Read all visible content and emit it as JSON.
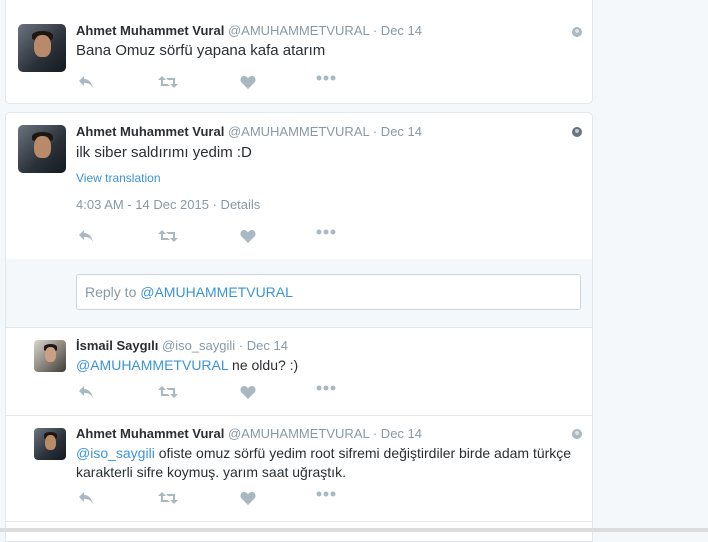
{
  "tweets": [
    {
      "name": "Ahmet Muhammet Vural",
      "handle": "@AMUHAMMETVURAL",
      "date": "· Dec 14",
      "text": "Bana Omuz sörfü yapana kafa atarım"
    },
    {
      "name": "Ahmet Muhammet Vural",
      "handle": "@AMUHAMMETVURAL",
      "date": "· Dec 14",
      "text": "ilk siber saldırımı yedim :D",
      "translate": "View translation",
      "timestamp": "4:03 AM - 14 Dec 2015",
      "details": "· Details"
    }
  ],
  "reply_box": {
    "prefix": "Reply to ",
    "mention": "@AMUHAMMETVURAL"
  },
  "replies": [
    {
      "name": "İsmail Saygılı",
      "handle": "@iso_saygili",
      "date": "· Dec 14",
      "mention": "@AMUHAMMETVURAL",
      "text": " ne oldu? :)"
    },
    {
      "name": "Ahmet Muhammet Vural",
      "handle": "@AMUHAMMETVURAL",
      "date": "· Dec 14",
      "mention": "@iso_saygili",
      "text": " ofiste omuz sörfü yedim root sifremi değiştirdiler birde adam türkçe karakterli sifre koymuş. yarım saat uğraştık."
    }
  ],
  "icons": {
    "reply": "reply-icon",
    "retweet": "retweet-icon",
    "like": "heart-icon",
    "more": "more-icon",
    "globe": "globe-icon"
  },
  "colors": {
    "link": "#3b94d9",
    "muted": "#8899a6",
    "icon": "#aab8c2"
  }
}
